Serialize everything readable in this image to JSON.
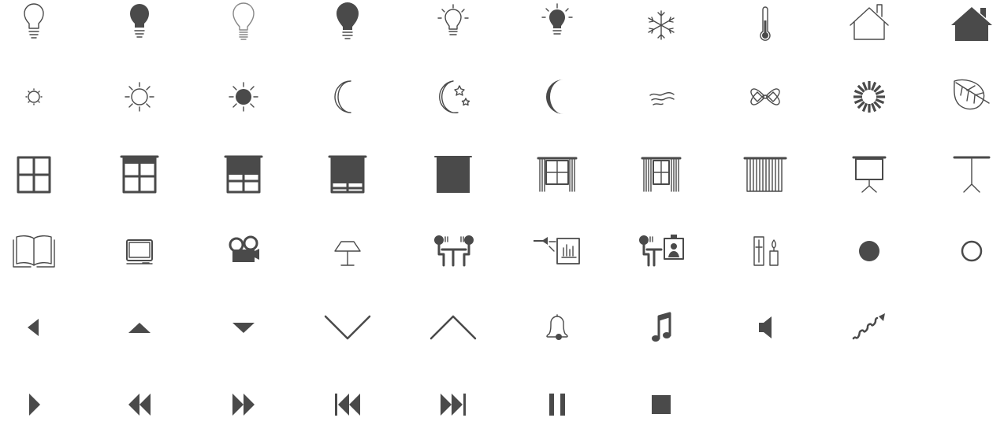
{
  "palette": {
    "icon_color": "#4a4a4a",
    "background": "#ffffff"
  },
  "rows": [
    [
      "light-bulb-outline-icon",
      "light-bulb-filled-icon",
      "light-bulb-clear-icon",
      "light-bulb-large-filled-icon",
      "light-bulb-on-outline-icon",
      "light-bulb-on-filled-icon",
      "snowflake-icon",
      "thermometer-icon",
      "house-outline-icon",
      "house-filled-icon"
    ],
    [
      "sun-small-icon",
      "sun-outline-icon",
      "sun-filled-icon",
      "moon-outline-icon",
      "moon-and-stars-icon",
      "moon-filled-icon",
      "wind-icon",
      "fan-icon",
      "spinner-burst-icon",
      "leaf-icon"
    ],
    [
      "window-open-icon",
      "window-blind-quarter-icon",
      "window-blind-half-icon",
      "window-blind-three-quarter-icon",
      "window-blind-closed-icon",
      "curtains-open-icon",
      "curtains-half-icon",
      "curtains-closed-icon",
      "projection-screen-icon",
      "projection-screen-rolled-icon"
    ],
    [
      "open-book-icon",
      "television-icon",
      "film-projector-icon",
      "table-lamp-icon",
      "conference-table-icon",
      "video-presentation-icon",
      "video-conference-icon",
      "dimmer-candle-icon",
      "dot-filled-icon",
      "dot-outline-icon"
    ],
    [
      "triangle-left-icon",
      "triangle-up-icon",
      "triangle-down-icon",
      "chevron-down-icon",
      "chevron-up-icon",
      "bell-icon",
      "music-note-icon",
      "speaker-icon",
      "squiggle-arrow-icon",
      ""
    ],
    [
      "play-icon",
      "rewind-icon",
      "fast-forward-icon",
      "skip-previous-icon",
      "skip-next-icon",
      "pause-icon",
      "stop-icon",
      "",
      "",
      ""
    ]
  ]
}
